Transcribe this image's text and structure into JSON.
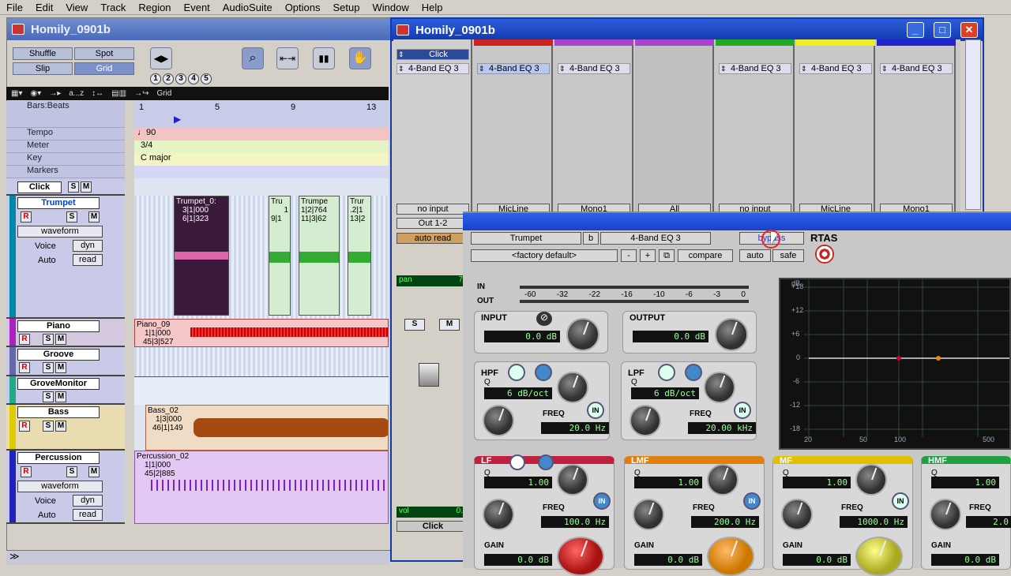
{
  "menu": [
    "File",
    "Edit",
    "View",
    "Track",
    "Region",
    "Event",
    "AudioSuite",
    "Options",
    "Setup",
    "Window",
    "Help"
  ],
  "edit_window": {
    "title": "Homily_0901b",
    "modes": {
      "shuffle": "Shuffle",
      "spot": "Spot",
      "slip": "Slip",
      "grid": "Grid"
    },
    "numbers": [
      "1",
      "2",
      "3",
      "4",
      "5"
    ],
    "toolbar": {
      "az": "a...z",
      "grid": "Grid"
    },
    "rulers": {
      "barsbeats": "Bars:Beats",
      "tempo": "Tempo",
      "meter": "Meter",
      "key": "Key",
      "markers": "Markers"
    },
    "ruler_values": {
      "tempo": "♩90",
      "meter": "3/4",
      "key": "C major"
    },
    "bar_numbers": [
      "1",
      "5",
      "9",
      "13"
    ],
    "tracks": [
      {
        "name": "Click"
      },
      {
        "name": "Trumpet",
        "view": "waveform",
        "voice": "Voice",
        "voice_val": "dyn",
        "auto": "Auto",
        "auto_val": "read"
      },
      {
        "name": "Piano"
      },
      {
        "name": "Groove"
      },
      {
        "name": "GroveMonitor"
      },
      {
        "name": "Bass"
      },
      {
        "name": "Percussion",
        "view": "waveform",
        "voice": "Voice",
        "voice_val": "dyn",
        "auto": "Auto",
        "auto_val": "read"
      }
    ],
    "clips": {
      "trumpet1_name": "Trumpet_0:",
      "trumpet1_a": "3|1|000",
      "trumpet1_b": "6|1|323",
      "trumpet2": "Tru",
      "trumpet2_a": "1",
      "trumpet2_b": "9|1",
      "trumpet3": "Trumpe",
      "trumpet3_a": "1|2|764",
      "trumpet3_b": "11|3|62",
      "trumpet4": "Trur",
      "trumpet4_a": ".2|1",
      "trumpet4_b": "13|2",
      "piano": "Piano_09",
      "piano_a": "1|1|000",
      "piano_b": "45|3|527",
      "bass": "Bass_02",
      "bass_a": "1|3|000",
      "bass_b": "46|1|149",
      "perc": "Percussion_02",
      "perc_a": "1|1|000",
      "perc_b": "45|2|885"
    }
  },
  "mix_window": {
    "title": "Homily_0901b",
    "click_label": "Click",
    "insert": "4-Band EQ 3",
    "io": {
      "in1": "no input",
      "out1": "Out 1-2",
      "auto1": "auto read",
      "in2": "MicLine",
      "in3": "Mono1",
      "in4": "All",
      "in5": "no input",
      "in6": "MicLine",
      "in7": "Mono1"
    },
    "pan": "pan",
    "pan_val": "7",
    "s": "S",
    "m": "M",
    "vol": "vol",
    "vol_val": "0.",
    "strip_name": "Click"
  },
  "plugin": {
    "track": "Trumpet",
    "b": "b",
    "name": "4-Band EQ 3",
    "bypass": "bypass",
    "format": "RTAS",
    "preset": "<factory default>",
    "minus": "-",
    "plus": "+",
    "compare": "compare",
    "auto": "auto",
    "safe": "safe",
    "meter_in": "IN",
    "meter_out": "OUT",
    "scale": [
      "-60",
      "-32",
      "-22",
      "-16",
      "-10",
      "-6",
      "-3",
      "0"
    ],
    "input": {
      "label": "INPUT",
      "value": "0.0 dB"
    },
    "output": {
      "label": "OUTPUT",
      "value": "0.0 dB"
    },
    "hpf": {
      "label": "HPF",
      "q": "Q",
      "slope": "6 dB/oct",
      "freq_label": "FREQ",
      "freq": "20.0 Hz",
      "in": "IN"
    },
    "lpf": {
      "label": "LPF",
      "q": "Q",
      "slope": "6 dB/oct",
      "freq_label": "FREQ",
      "freq": "20.00 kHz",
      "in": "IN"
    },
    "lf": {
      "label": "LF",
      "q": "Q",
      "q_val": "1.00",
      "freq_label": "FREQ",
      "freq": "100.0 Hz",
      "gain_label": "GAIN",
      "gain": "0.0 dB",
      "in": "IN"
    },
    "lmf": {
      "label": "LMF",
      "q": "Q",
      "q_val": "1.00",
      "freq_label": "FREQ",
      "freq": "200.0 Hz",
      "gain_label": "GAIN",
      "gain": "0.0 dB",
      "in": "IN"
    },
    "mf": {
      "label": "MF",
      "q": "Q",
      "q_val": "1.00",
      "freq_label": "FREQ",
      "freq": "1000.0 Hz",
      "gain_label": "GAIN",
      "gain": "0.0 dB",
      "in": "IN"
    },
    "hmf": {
      "label": "HMF",
      "q": "Q",
      "q_val": "1.00",
      "freq_label": "FREQ",
      "freq": "2.0",
      "gain_label": "GAIN",
      "gain": "0.0 dB"
    },
    "graph": {
      "db": "dB",
      "y": [
        "+18",
        "+12",
        "+6",
        "0",
        "-6",
        "-12",
        "-18"
      ],
      "x": [
        "20",
        "50",
        "100",
        "500"
      ]
    }
  },
  "colors": {
    "accent": "#1038b0",
    "lf": "#c02040",
    "lmf": "#e08010",
    "mf": "#e0c000",
    "hmf": "#20a040"
  }
}
